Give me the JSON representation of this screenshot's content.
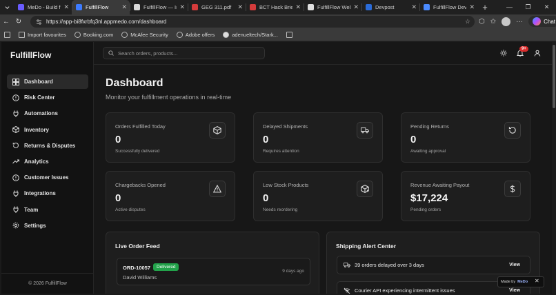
{
  "browser": {
    "tabs": [
      {
        "title": "MeDo - Build full-stack",
        "color": "#6a5cff",
        "active": false
      },
      {
        "title": "FulfillFlow",
        "color": "#3d7bff",
        "active": true
      },
      {
        "title": "FulfillFlow — Investor",
        "color": "#d8d8d8",
        "active": false
      },
      {
        "title": "GEG 311.pdf",
        "color": "#d43b3b",
        "active": false
      },
      {
        "title": "BCT Hack Brief.pdf",
        "color": "#d43b3b",
        "active": false
      },
      {
        "title": "FulfillFlow Web App",
        "color": "#e0e0e0",
        "active": false
      },
      {
        "title": "Devpost",
        "color": "#2a6bd8",
        "active": false
      },
      {
        "title": "FulfillFlow Development",
        "color": "#4b8bff",
        "active": false
      }
    ],
    "url": "https://app-bi8fxrbfq3nl.appmedo.com/dashboard",
    "chat_label": "Chat",
    "bookmarks": [
      {
        "label": "Import favourites"
      },
      {
        "label": "Booking.com"
      },
      {
        "label": "McAfee Security"
      },
      {
        "label": "Adobe offers"
      },
      {
        "label": "adenueltech/Stark..."
      }
    ]
  },
  "app": {
    "brand": "FulfillFlow",
    "nav": [
      {
        "label": "Dashboard",
        "icon": "dashboard-icon",
        "active": true
      },
      {
        "label": "Risk Center",
        "icon": "alert-circle-icon",
        "active": false
      },
      {
        "label": "Automations",
        "icon": "plug-icon",
        "active": false
      },
      {
        "label": "Inventory",
        "icon": "box-icon",
        "active": false
      },
      {
        "label": "Returns & Disputes",
        "icon": "rotate-icon",
        "active": false
      },
      {
        "label": "Analytics",
        "icon": "trending-icon",
        "active": false
      },
      {
        "label": "Customer Issues",
        "icon": "alert-circle-icon",
        "active": false
      },
      {
        "label": "Integrations",
        "icon": "plug-icon",
        "active": false
      },
      {
        "label": "Team",
        "icon": "users-icon",
        "active": false
      },
      {
        "label": "Settings",
        "icon": "gear-icon",
        "active": false
      }
    ],
    "footer": "© 2026 FulfillFlow",
    "search_placeholder": "Search orders, products...",
    "notification_badge": "9+",
    "page_title": "Dashboard",
    "page_subtitle": "Monitor your fulfillment operations in real-time",
    "stats": [
      {
        "label": "Orders Fulfilled Today",
        "value": "0",
        "sub": "Successfully delivered",
        "icon": "box-icon"
      },
      {
        "label": "Delayed Shipments",
        "value": "0",
        "sub": "Requires attention",
        "icon": "truck-icon"
      },
      {
        "label": "Pending Returns",
        "value": "0",
        "sub": "Awaiting approval",
        "icon": "rotate-icon"
      },
      {
        "label": "Chargebacks Opened",
        "value": "0",
        "sub": "Active disputes",
        "icon": "warning-icon"
      },
      {
        "label": "Low Stock Products",
        "value": "0",
        "sub": "Needs reordering",
        "icon": "package-alert-icon"
      },
      {
        "label": "Revenue Awaiting Payout",
        "value": "$17,224",
        "sub": "Pending orders",
        "icon": "dollar-icon"
      }
    ],
    "live_feed": {
      "title": "Live Order Feed",
      "orders": [
        {
          "id": "ORD-10057",
          "status": "Delivered",
          "customer": "David Williams",
          "time": "9 days ago"
        }
      ]
    },
    "shipping_alerts": {
      "title": "Shipping Alert Center",
      "alerts": [
        {
          "text": "39 orders delayed over 3 days",
          "action": "View",
          "icon": "truck-icon"
        },
        {
          "text": "Courier API experiencing intermittent issues",
          "action": "View",
          "icon": "wifi-off-icon"
        }
      ]
    },
    "made_by": {
      "prefix": "Made by",
      "brand": "MeDo"
    }
  }
}
